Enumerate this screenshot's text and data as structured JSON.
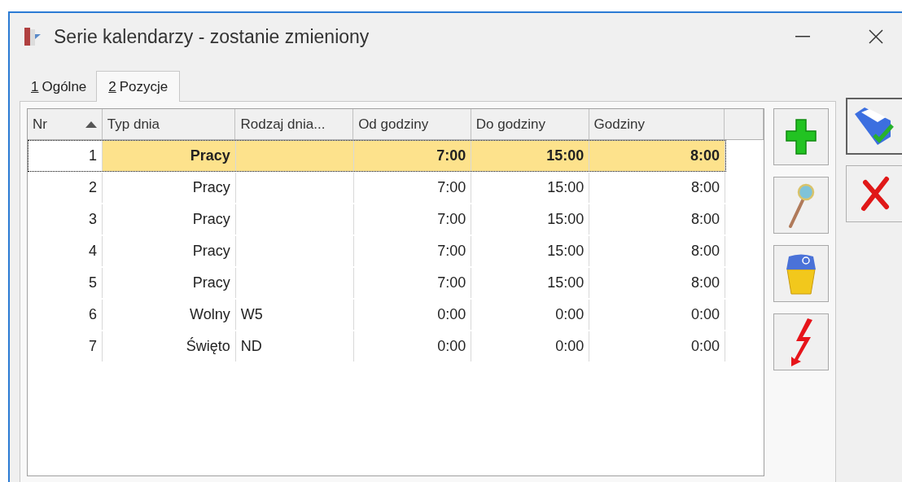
{
  "window": {
    "title": "Serie kalendarzy - zostanie zmieniony"
  },
  "tabs": [
    {
      "mnemonic": "1",
      "label": "Ogólne",
      "selected": false
    },
    {
      "mnemonic": "2",
      "label": "Pozycje",
      "selected": true
    }
  ],
  "table": {
    "columns": [
      {
        "label": "Nr",
        "sorted": true
      },
      {
        "label": "Typ dnia",
        "sorted": false
      },
      {
        "label": "Rodzaj dnia...",
        "sorted": false
      },
      {
        "label": "Od godziny",
        "sorted": false
      },
      {
        "label": "Do godziny",
        "sorted": false
      },
      {
        "label": "Godziny",
        "sorted": false
      }
    ],
    "rows": [
      {
        "cells": [
          "1",
          "Pracy",
          "",
          "7:00",
          "15:00",
          "8:00"
        ],
        "selected": true
      },
      {
        "cells": [
          "2",
          "Pracy",
          "",
          "7:00",
          "15:00",
          "8:00"
        ],
        "selected": false
      },
      {
        "cells": [
          "3",
          "Pracy",
          "",
          "7:00",
          "15:00",
          "8:00"
        ],
        "selected": false
      },
      {
        "cells": [
          "4",
          "Pracy",
          "",
          "7:00",
          "15:00",
          "8:00"
        ],
        "selected": false
      },
      {
        "cells": [
          "5",
          "Pracy",
          "",
          "7:00",
          "15:00",
          "8:00"
        ],
        "selected": false
      },
      {
        "cells": [
          "6",
          "Wolny",
          "W5",
          "0:00",
          "0:00",
          "0:00"
        ],
        "selected": false
      },
      {
        "cells": [
          "7",
          "Święto",
          "ND",
          "0:00",
          "0:00",
          "0:00"
        ],
        "selected": false
      }
    ]
  },
  "side_buttons": [
    {
      "kind": "add"
    },
    {
      "kind": "view"
    },
    {
      "kind": "delete"
    },
    {
      "kind": "run"
    }
  ],
  "dialog_buttons": [
    {
      "kind": "save"
    },
    {
      "kind": "cancel"
    }
  ]
}
